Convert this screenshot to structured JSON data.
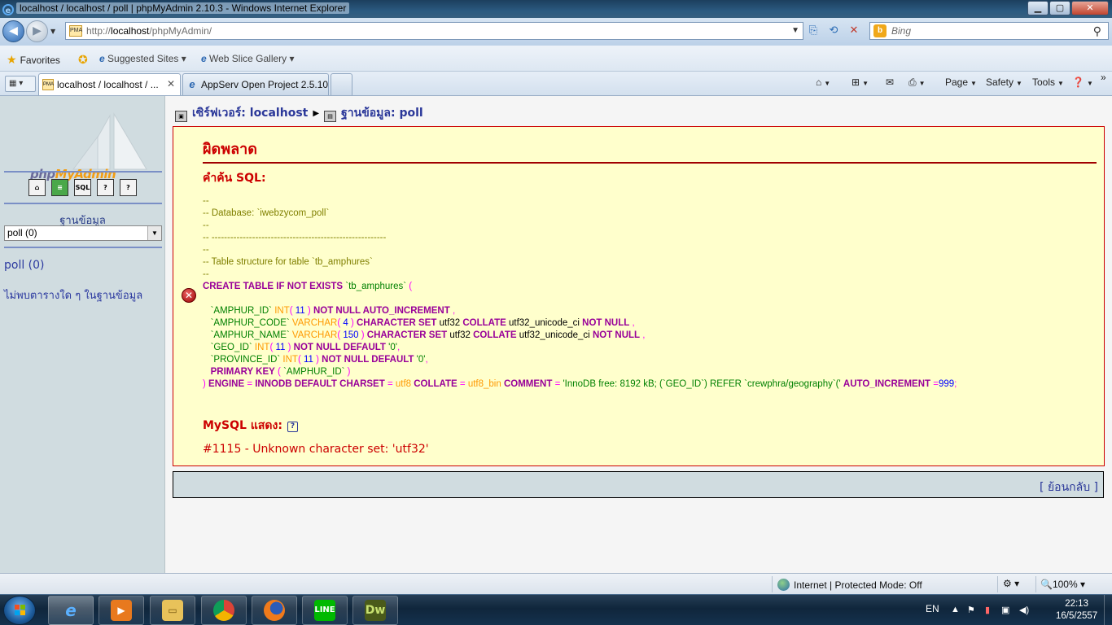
{
  "window": {
    "title": "localhost / localhost / poll | phpMyAdmin 2.10.3 - Windows Internet Explorer",
    "min_glyph": "▁",
    "max_glyph": "▢",
    "close_glyph": "✕"
  },
  "address_bar": {
    "url_prefix": "http://",
    "url_host": "localhost",
    "url_path": "/phpMyAdmin/",
    "search_placeholder": "Bing"
  },
  "favorites_bar": {
    "favorites_label": "Favorites",
    "items": [
      {
        "label": "Suggested Sites ▾",
        "icon": "ie-icon"
      },
      {
        "label": "Web Slice Gallery ▾",
        "icon": "ie-icon"
      }
    ]
  },
  "tabs": [
    {
      "label": "localhost / localhost / ...",
      "active": true,
      "icon": "pma-icon"
    },
    {
      "label": "AppServ Open Project 2.5.10",
      "active": false,
      "icon": "ie-icon"
    }
  ],
  "command_bar": {
    "page_label": "Page",
    "safety_label": "Safety",
    "tools_label": "Tools"
  },
  "sidebar": {
    "logo_text_php": "php",
    "logo_text_rest": "MyAdmin",
    "icons": [
      "home-icon",
      "query-window-icon",
      "sql-icon",
      "docs-icon",
      "help-icon"
    ],
    "db_label": "ฐานข้อมูล",
    "db_select_value": "poll (0)",
    "db_link": "poll (0)",
    "no_tables_text": "ไม่พบตารางใด ๆ ในฐานข้อมูล"
  },
  "breadcrumb": {
    "server_label": "เซิร์ฟเวอร์: localhost",
    "db_label": "ฐานข้อมูล: poll"
  },
  "error": {
    "title": "ผิดพลาด",
    "sql_heading": "คำค้น SQL:",
    "mysql_heading": "MySQL แสดง:",
    "message": "#1115 - Unknown character set: 'utf32'"
  },
  "sql_lines": [
    [
      [
        "cm",
        "--"
      ]
    ],
    [
      [
        "cm",
        "-- Database: `iwebzycom_poll`"
      ]
    ],
    [
      [
        "cm",
        "--"
      ]
    ],
    [
      [
        "cm",
        "-- --------------------------------------------------------"
      ]
    ],
    [
      [
        "cm",
        "--"
      ]
    ],
    [
      [
        "cm",
        "-- Table structure for table `tb_amphures`"
      ]
    ],
    [
      [
        "cm",
        "--"
      ]
    ],
    [
      [
        "kw",
        "CREATE TABLE IF NOT EXISTS "
      ],
      [
        "st",
        "`tb_amphures`"
      ],
      [
        "pn",
        " ("
      ]
    ],
    [
      [
        "pl",
        ""
      ]
    ],
    [
      [
        "pl",
        "   "
      ],
      [
        "st",
        "`AMPHUR_ID`"
      ],
      [
        "pl",
        " "
      ],
      [
        "ty",
        "INT"
      ],
      [
        "pn",
        "( "
      ],
      [
        "nm",
        "11"
      ],
      [
        "pn",
        " )"
      ],
      [
        "pl",
        " "
      ],
      [
        "kw",
        "NOT NULL AUTO_INCREMENT"
      ],
      [
        "pn",
        " ,"
      ]
    ],
    [
      [
        "pl",
        "   "
      ],
      [
        "st",
        "`AMPHUR_CODE`"
      ],
      [
        "pl",
        " "
      ],
      [
        "ty",
        "VARCHAR"
      ],
      [
        "pn",
        "( "
      ],
      [
        "nm",
        "4"
      ],
      [
        "pn",
        " )"
      ],
      [
        "pl",
        " "
      ],
      [
        "kw",
        "CHARACTER SET"
      ],
      [
        "pl",
        " utf32 "
      ],
      [
        "kw",
        "COLLATE"
      ],
      [
        "pl",
        " utf32_unicode_ci "
      ],
      [
        "kw",
        "NOT NULL"
      ],
      [
        "pn",
        " ,"
      ]
    ],
    [
      [
        "pl",
        "   "
      ],
      [
        "st",
        "`AMPHUR_NAME`"
      ],
      [
        "pl",
        " "
      ],
      [
        "ty",
        "VARCHAR"
      ],
      [
        "pn",
        "( "
      ],
      [
        "nm",
        "150"
      ],
      [
        "pn",
        " )"
      ],
      [
        "pl",
        " "
      ],
      [
        "kw",
        "CHARACTER SET"
      ],
      [
        "pl",
        " utf32 "
      ],
      [
        "kw",
        "COLLATE"
      ],
      [
        "pl",
        " utf32_unicode_ci "
      ],
      [
        "kw",
        "NOT NULL"
      ],
      [
        "pn",
        " ,"
      ]
    ],
    [
      [
        "pl",
        "   "
      ],
      [
        "st",
        "`GEO_ID`"
      ],
      [
        "pl",
        " "
      ],
      [
        "ty",
        "INT"
      ],
      [
        "pn",
        "( "
      ],
      [
        "nm",
        "11"
      ],
      [
        "pn",
        " )"
      ],
      [
        "pl",
        " "
      ],
      [
        "kw",
        "NOT NULL DEFAULT"
      ],
      [
        "pl",
        " "
      ],
      [
        "st",
        "'0'"
      ],
      [
        "pn",
        ","
      ]
    ],
    [
      [
        "pl",
        "   "
      ],
      [
        "st",
        "`PROVINCE_ID`"
      ],
      [
        "pl",
        " "
      ],
      [
        "ty",
        "INT"
      ],
      [
        "pn",
        "( "
      ],
      [
        "nm",
        "11"
      ],
      [
        "pn",
        " )"
      ],
      [
        "pl",
        " "
      ],
      [
        "kw",
        "NOT NULL DEFAULT"
      ],
      [
        "pl",
        " "
      ],
      [
        "st",
        "'0'"
      ],
      [
        "pn",
        ","
      ]
    ],
    [
      [
        "pl",
        "   "
      ],
      [
        "kw",
        "PRIMARY KEY"
      ],
      [
        "pn",
        " ( "
      ],
      [
        "st",
        "`AMPHUR_ID`"
      ],
      [
        "pn",
        " )"
      ]
    ],
    [
      [
        "pn",
        ") "
      ],
      [
        "kw",
        "ENGINE"
      ],
      [
        "pn",
        " = "
      ],
      [
        "kw",
        "INNODB DEFAULT CHARSET"
      ],
      [
        "pn",
        " = "
      ],
      [
        "ty",
        "utf8"
      ],
      [
        "pl",
        " "
      ],
      [
        "kw",
        "COLLATE"
      ],
      [
        "pn",
        " = "
      ],
      [
        "ty",
        "utf8_bin"
      ],
      [
        "pl",
        " "
      ],
      [
        "kw",
        "COMMENT"
      ],
      [
        "pn",
        " = "
      ],
      [
        "st",
        "'InnoDB free: 8192 kB; (`GEO_ID`) REFER `crewphra/geography`('"
      ],
      [
        "pl",
        " "
      ],
      [
        "kw",
        "AUTO_INCREMENT"
      ],
      [
        "pn",
        " ="
      ],
      [
        "nm",
        "999"
      ],
      [
        "pn",
        ";"
      ]
    ]
  ],
  "back_link": "[ ย้อนกลับ ]",
  "status_bar": {
    "zone_text": "Internet | Protected Mode: Off",
    "zoom_text": "🔍100% ▾"
  },
  "taskbar": {
    "apps": [
      "ie-icon",
      "media-player-icon",
      "explorer-icon",
      "chrome-icon",
      "firefox-icon",
      "line-icon",
      "dreamweaver-icon"
    ],
    "line_label": "LINE",
    "dw_label": "Dw",
    "lang": "EN",
    "time": "22:13",
    "date": "16/5/2557"
  },
  "colors": {
    "error_red": "#cc0000",
    "error_bg": "#ffffcc",
    "sidebar_bg": "#d0dce0",
    "link_blue": "#2a3799"
  }
}
